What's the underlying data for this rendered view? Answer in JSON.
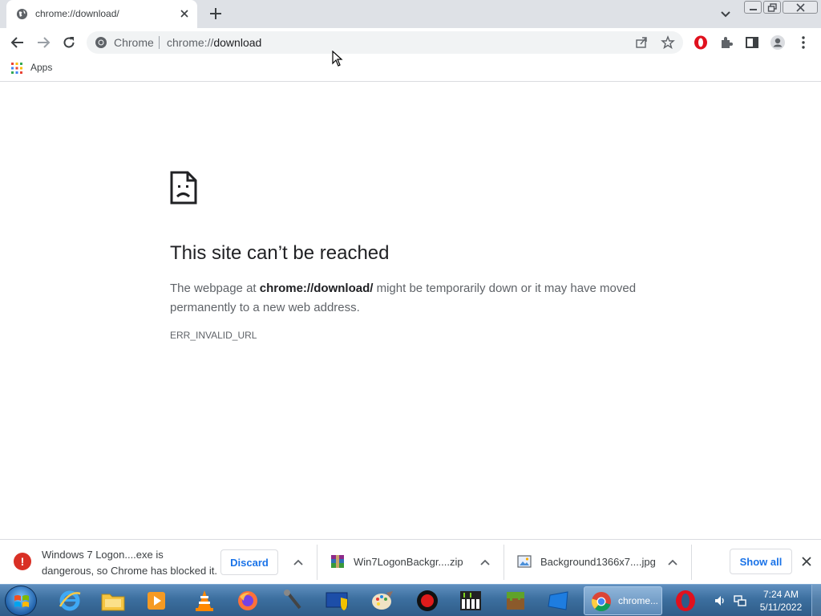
{
  "tab": {
    "title": "chrome://download/"
  },
  "toolbar": {
    "omnibox_chip": "Chrome",
    "url_scheme": "chrome://",
    "url_path": "download"
  },
  "bookmarks": {
    "apps_label": "Apps"
  },
  "error_page": {
    "title": "This site can’t be reached",
    "desc_prefix": "The webpage at ",
    "desc_url": "chrome://download/",
    "desc_suffix": " might be temporarily down or it may have moved permanently to a new web address.",
    "code": "ERR_INVALID_URL"
  },
  "download_shelf": {
    "blocked_item": {
      "message": "Windows 7 Logon....exe is dangerous, so Chrome has blocked it.",
      "discard_label": "Discard"
    },
    "items": [
      {
        "name": "Win7LogonBackgr....zip",
        "icon": "winrar-archive-icon"
      },
      {
        "name": "Background1366x7....jpg",
        "icon": "image-file-icon"
      }
    ],
    "show_all_label": "Show all"
  },
  "taskbar": {
    "active_label": "chrome...",
    "time": "7:24 AM",
    "date": "5/11/2022"
  },
  "colors": {
    "tabstrip": "#dee1e6",
    "omnibox": "#f1f3f4",
    "link_blue": "#1a73e8",
    "danger_red": "#d93025"
  }
}
